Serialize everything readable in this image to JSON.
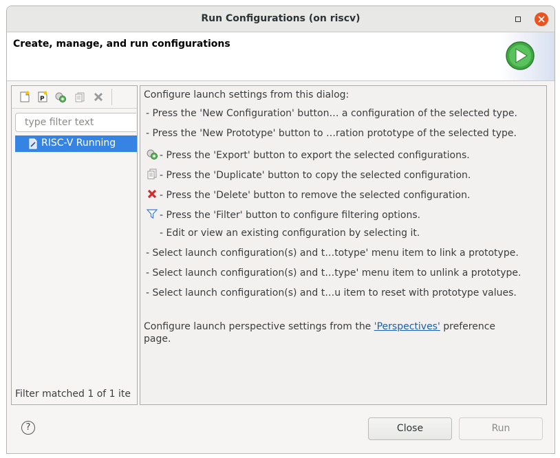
{
  "window": {
    "title": "Run Configurations  (on riscv)"
  },
  "header": {
    "title": "Create, manage, and run configurations"
  },
  "toolbar": {
    "icons": [
      "new-configuration-icon",
      "new-prototype-icon",
      "export-icon",
      "duplicate-icon",
      "delete-icon"
    ]
  },
  "filter": {
    "placeholder": "type filter text"
  },
  "tree": {
    "items": [
      {
        "label": "RISC-V Running"
      }
    ]
  },
  "left_footer": "Filter matched 1 of 1 ite",
  "main": {
    "intro": "Configure launch settings from this dialog:",
    "lines": [
      "- Press the 'New Configuration' button… a configuration of the selected type.",
      "- Press the 'New Prototype' button to …ration prototype of the selected type.",
      "- Press the 'Export' button to export the selected configurations.",
      "- Press the 'Duplicate' button to copy the selected configuration.",
      "- Press the 'Delete' button to remove the selected configuration.",
      "- Press the 'Filter' button to configure filtering options.",
      "- Edit or view an existing configuration by selecting it.",
      "- Select launch configuration(s) and t…totype' menu item to link a prototype.",
      "- Select launch configuration(s) and t…type' menu item to unlink a prototype.",
      "- Select launch configuration(s) and t…u item to reset with prototype values."
    ],
    "perspective_prefix": "Configure launch perspective settings from the ",
    "perspective_link": "'Perspectives'",
    "perspective_suffix": " preference",
    "perspective_line2": "page."
  },
  "buttons": {
    "close": "Close",
    "run": "Run",
    "help": "?"
  },
  "colors": {
    "selection": "#3584e4",
    "close_button": "#e95420",
    "link": "#1a5fb4"
  }
}
